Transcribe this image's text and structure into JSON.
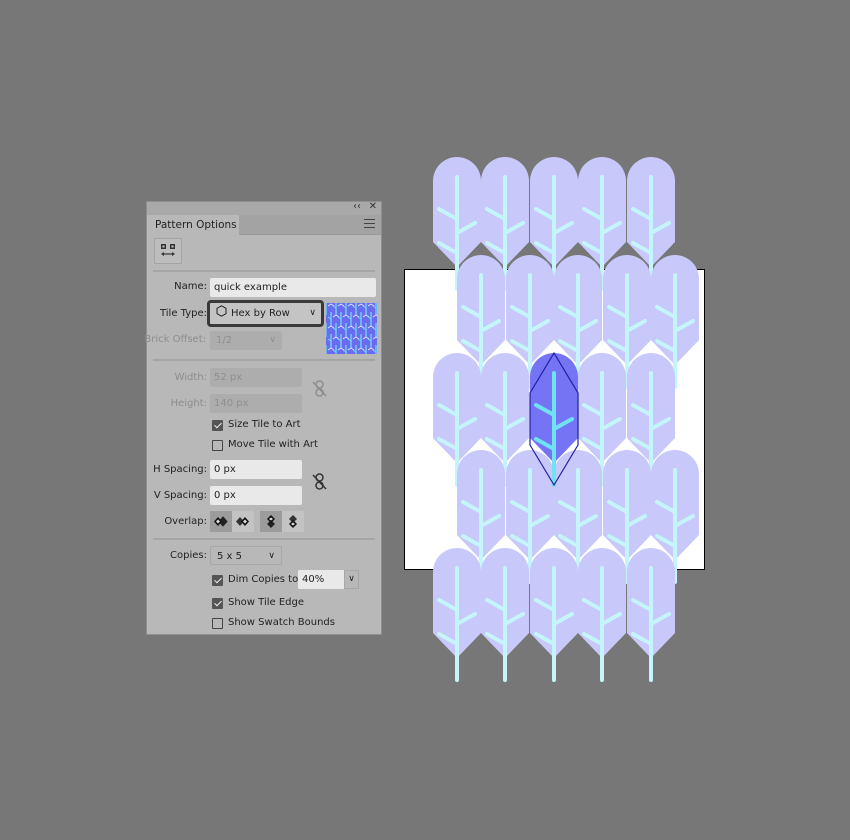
{
  "panel": {
    "title": "Pattern Options",
    "collapse_icon": "double-chevron-left-icon",
    "close_icon": "close-icon",
    "menu_icon": "hamburger-menu-icon",
    "tile_tool_icon": "pattern-tile-tool-icon",
    "name_label": "Name:",
    "name_value": "quick example",
    "tile_type_label": "Tile Type:",
    "tile_type_value": "Hex by Row",
    "tile_type_icon": "hexagon-icon",
    "brick_offset_label": "Brick Offset:",
    "brick_offset_value": "1/2",
    "width_label": "Width:",
    "width_value": "52 px",
    "height_label": "Height:",
    "height_value": "140 px",
    "size_link_icon": "unlinked-chain-icon",
    "size_tile_to_art_label": "Size Tile to Art",
    "size_tile_to_art_checked": true,
    "move_tile_with_art_label": "Move Tile with Art",
    "move_tile_with_art_checked": false,
    "h_spacing_label": "H Spacing:",
    "h_spacing_value": "0 px",
    "v_spacing_label": "V Spacing:",
    "v_spacing_value": "0 px",
    "spacing_link_icon": "unlinked-chain-icon",
    "overlap_label": "Overlap:",
    "overlap_buttons": [
      {
        "name": "left-in-front",
        "icon": "overlap-left-front-icon",
        "active": true
      },
      {
        "name": "right-in-front",
        "icon": "overlap-right-front-icon",
        "active": false
      },
      {
        "name": "top-in-front",
        "icon": "overlap-top-front-icon",
        "active": true
      },
      {
        "name": "bottom-in-front",
        "icon": "overlap-bottom-front-icon",
        "active": false
      }
    ],
    "copies_label": "Copies:",
    "copies_value": "5 x 5",
    "dim_copies_label": "Dim Copies to:",
    "dim_copies_checked": true,
    "dim_copies_value": "40%",
    "show_tile_edge_label": "Show Tile Edge",
    "show_tile_edge_checked": true,
    "show_swatch_bounds_label": "Show Swatch Bounds",
    "show_swatch_bounds_checked": false
  },
  "canvas": {
    "artwork": "leaf pattern",
    "colors": {
      "leaf_dim": "#c8c8fb",
      "stem_dim": "#c4f5fb",
      "leaf_active": "#7474f5",
      "stem_active": "#6fe2f4",
      "tile_edge": "#1f1fa0",
      "swatch_bounds_fill": "#ffffff",
      "canvas_bg": "#777777"
    }
  }
}
